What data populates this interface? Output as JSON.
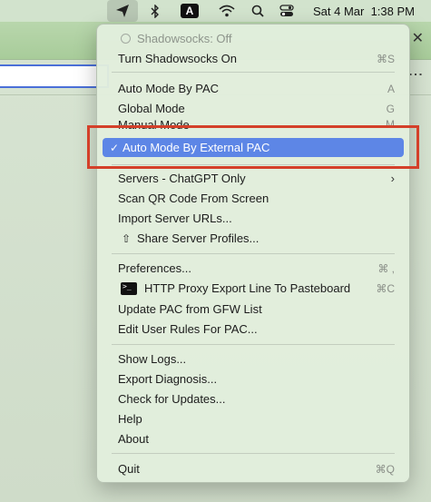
{
  "menubar": {
    "date_time": "Sat 4 Mar  1:38 PM",
    "input_source": "A"
  },
  "menu": {
    "status": "Shadowsocks: Off",
    "items": [
      {
        "label": "Turn Shadowsocks On",
        "shortcut": "⌘S"
      },
      {
        "label": "Auto Mode By PAC",
        "shortcut": "A"
      },
      {
        "label": "Global Mode",
        "shortcut": "G"
      },
      {
        "label": "Manual Mode",
        "shortcut": "M"
      },
      {
        "label": "Auto Mode By External PAC",
        "checked": "✓"
      },
      {
        "label": "Servers - ChatGPT Only"
      },
      {
        "label": "Scan QR Code From Screen"
      },
      {
        "label": "Import Server URLs..."
      },
      {
        "label": "Share Server Profiles..."
      },
      {
        "label": "Preferences...",
        "shortcut": "⌘ ,"
      },
      {
        "label": "HTTP Proxy Export Line To Pasteboard",
        "shortcut": "⌘C"
      },
      {
        "label": "Update PAC from GFW List"
      },
      {
        "label": "Edit User Rules For PAC..."
      },
      {
        "label": "Show Logs..."
      },
      {
        "label": "Export Diagnosis..."
      },
      {
        "label": "Check for Updates..."
      },
      {
        "label": "Help"
      },
      {
        "label": "About"
      },
      {
        "label": "Quit",
        "shortcut": "⌘Q"
      }
    ]
  },
  "colors": {
    "selection": "#5d86e6",
    "annotation": "#d4402a"
  }
}
